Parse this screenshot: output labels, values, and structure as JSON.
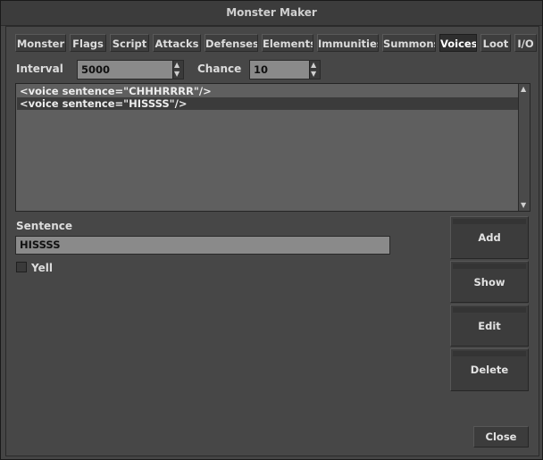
{
  "window": {
    "title": "Monster Maker"
  },
  "tabs": [
    {
      "label": "Monster"
    },
    {
      "label": "Flags"
    },
    {
      "label": "Script"
    },
    {
      "label": "Attacks"
    },
    {
      "label": "Defenses"
    },
    {
      "label": "Elements"
    },
    {
      "label": "Immunities"
    },
    {
      "label": "Summons"
    },
    {
      "label": "Voices",
      "active": true
    },
    {
      "label": "Loot"
    },
    {
      "label": "I/O"
    }
  ],
  "interval": {
    "label": "Interval",
    "value": "5000"
  },
  "chance": {
    "label": "Chance",
    "value": "10"
  },
  "voices_list": [
    {
      "text": "<voice sentence=\"CHHHRRRR\"/>"
    },
    {
      "text": "<voice sentence=\"HISSSS\"/>",
      "selected": true
    }
  ],
  "sentence": {
    "label": "Sentence",
    "value": "HISSSS"
  },
  "yell": {
    "label": "Yell",
    "checked": false
  },
  "buttons": {
    "add": "Add",
    "show": "Show",
    "edit": "Edit",
    "delete": "Delete",
    "close": "Close"
  },
  "icons": {
    "spin_up": "chevron-up-icon",
    "spin_down": "chevron-down-icon"
  }
}
